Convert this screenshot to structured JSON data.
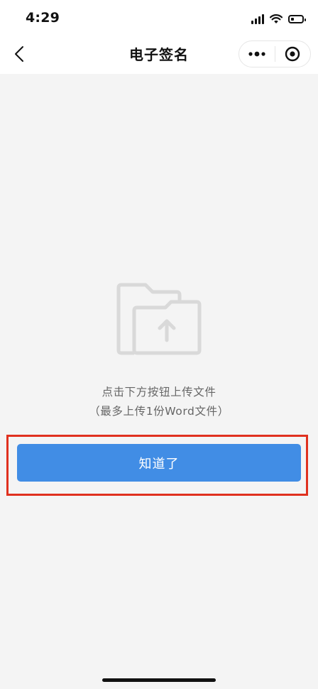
{
  "status_bar": {
    "time": "4:29",
    "battery_level": 0.3,
    "icons": [
      "signal-icon",
      "wifi-icon",
      "battery-icon"
    ]
  },
  "nav": {
    "title": "电子签名",
    "back_icon": "chevron-left-icon",
    "more_icon": "more-dots-icon",
    "close_icon": "target-circle-icon"
  },
  "empty_state": {
    "icon": "folder-upload-icon",
    "line1": "点击下方按钮上传文件",
    "line2": "（最多上传1份Word文件）"
  },
  "primary_button": {
    "label": "知道了",
    "color": "#418de5",
    "highlight_color": "#e0311f"
  },
  "colors": {
    "background": "#f4f4f4",
    "icon_gray": "#d9d9d9"
  }
}
